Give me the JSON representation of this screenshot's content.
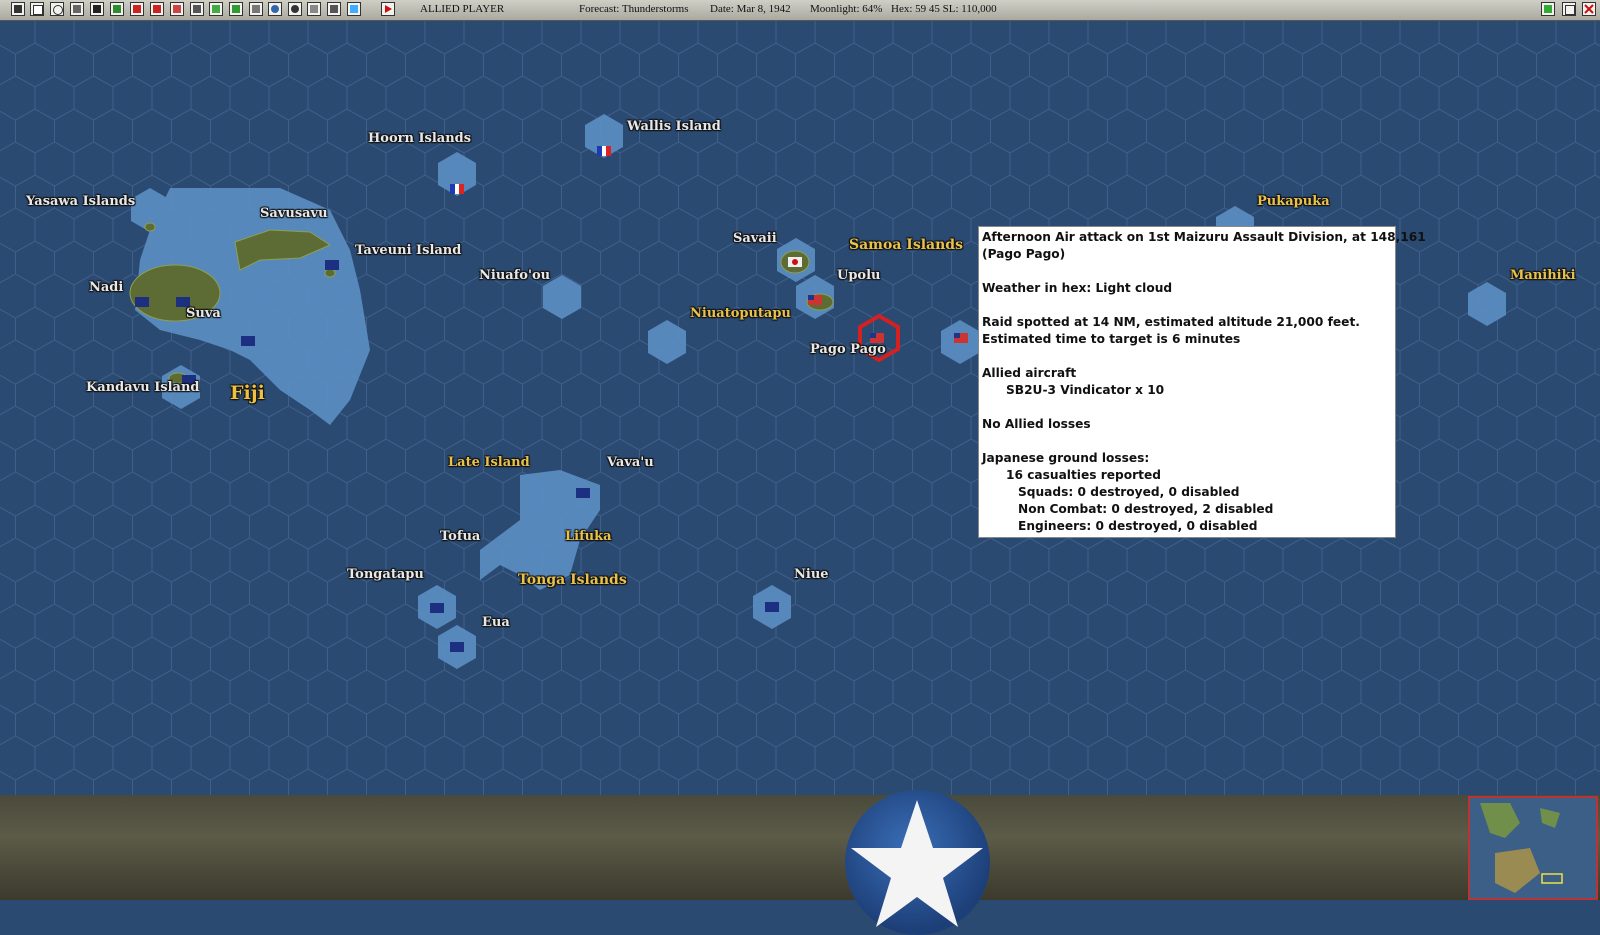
{
  "topbar": {
    "player": "ALLIED PLAYER",
    "forecast": "Forecast: Thunderstorms",
    "date": "Date: Mar 8, 1942",
    "moonlight": "Moonlight: 64%",
    "hex_info": "Hex: 59 45  SL: 110,000"
  },
  "map_labels": {
    "hoorn": "Hoorn Islands",
    "wallis": "Wallis Island",
    "yasawa": "Yasawa Islands",
    "savusavu": "Savusavu",
    "taveuni": "Taveuni Island",
    "nadi": "Nadi",
    "suva": "Suva",
    "kandavu": "Kandavu Island",
    "fiji": "Fiji",
    "niuafoou": "Niuafo'ou",
    "niuatoputapu": "Niuatoputapu",
    "savaii": "Savaii",
    "samoa": "Samoa Islands",
    "upolu": "Upolu",
    "pago_pago": "Pago Pago",
    "pukapuka": "Pukapuka",
    "manihiki": "Manihiki",
    "late": "Late Island",
    "vavau": "Vava'u",
    "tofua": "Tofua",
    "lifuka": "Lifuka",
    "tongatapu": "Tongatapu",
    "tonga": "Tonga Islands",
    "niue": "Niue",
    "eua": "Eua"
  },
  "combat_report": {
    "line1": "Afternoon Air attack on 1st Maizuru Assault Division, at 148,161",
    "line2": "(Pago Pago)",
    "weather": "Weather in hex: Light cloud",
    "raid1": "Raid spotted at 14 NM, estimated altitude 21,000 feet.",
    "raid2": "Estimated time to target is 6 minutes",
    "allied_header": "Allied aircraft",
    "allied_aircraft": "SB2U-3 Vindicator x 10",
    "allied_losses": "No Allied losses",
    "jp_header": "Japanese ground losses:",
    "jp_casualties": "16 casualties reported",
    "squads": "Squads: 0 destroyed, 0 disabled",
    "noncombat": "Non Combat: 0 destroyed, 2 disabled",
    "engineers": "Engineers: 0 destroyed, 0 disabled"
  },
  "colors": {
    "ocean": "#2b4a72",
    "shallow": "#5c8fc4",
    "label_gold": "#e8c24a",
    "selected_hex": "#d42020"
  }
}
